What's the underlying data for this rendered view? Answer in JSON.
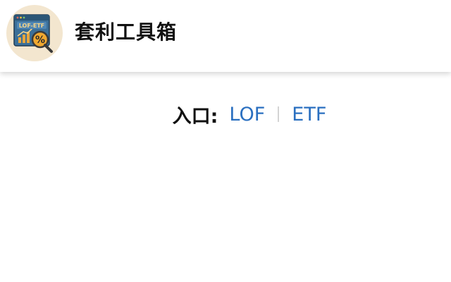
{
  "header": {
    "title": "套利工具箱",
    "logo": {
      "icon": "lof-etf-arbitrage-logo",
      "text": "LOF-ETF",
      "symbol": "%",
      "colors": {
        "background": "#f3e6cf",
        "window": "#3b6f98",
        "window_header": "#2c5676",
        "accent": "#f0a830",
        "chart": "#e8a63c",
        "glass": "#3a3a3a"
      }
    }
  },
  "entry": {
    "label": "入口:",
    "links": [
      {
        "label": "LOF"
      },
      {
        "label": "ETF"
      }
    ]
  },
  "colors": {
    "link": "#2a6fc0",
    "separator": "#d4d4d4",
    "text": "#111111"
  }
}
